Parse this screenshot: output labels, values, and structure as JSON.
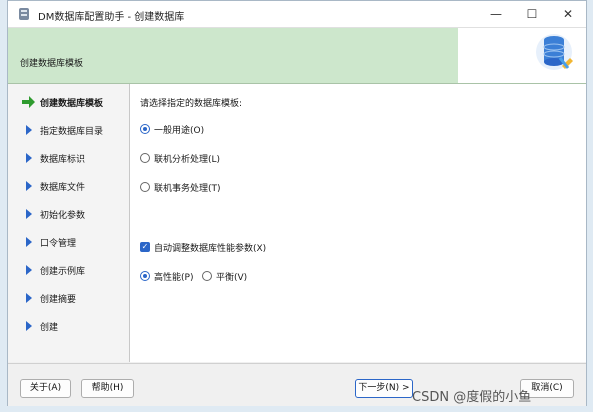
{
  "window": {
    "title": "DM数据库配置助手 - 创建数据库",
    "controls": [
      "—",
      "☐",
      "✕"
    ]
  },
  "header": {
    "title": "创建数据库模板"
  },
  "sidebar": {
    "items": [
      {
        "label": "创建数据库模板",
        "active": true
      },
      {
        "label": "指定数据库目录"
      },
      {
        "label": "数据库标识"
      },
      {
        "label": "数据库文件"
      },
      {
        "label": "初始化参数"
      },
      {
        "label": "口令管理"
      },
      {
        "label": "创建示例库"
      },
      {
        "label": "创建摘要"
      },
      {
        "label": "创建"
      }
    ]
  },
  "main": {
    "prompt": "请选择指定的数据库模板:",
    "templates": [
      {
        "label": "一般用途(O)",
        "selected": true
      },
      {
        "label": "联机分析处理(L)",
        "selected": false
      },
      {
        "label": "联机事务处理(T)",
        "selected": false
      }
    ],
    "auto_tune": {
      "label": "自动调整数据库性能参数(X)",
      "checked": true
    },
    "performance": [
      {
        "label": "高性能(P)",
        "selected": true
      },
      {
        "label": "平衡(V)",
        "selected": false
      }
    ]
  },
  "footer": {
    "about": "关于(A)",
    "help": "帮助(H)",
    "next": "下一步(N) >",
    "cancel": "取消(C)"
  },
  "watermark": "CSDN @度假的小鱼",
  "colors": {
    "accent": "#2b66c8",
    "header_bg": "#cde7cc",
    "nav_arrow": "#2b66c8",
    "active_arrow": "#2e9b2e"
  }
}
